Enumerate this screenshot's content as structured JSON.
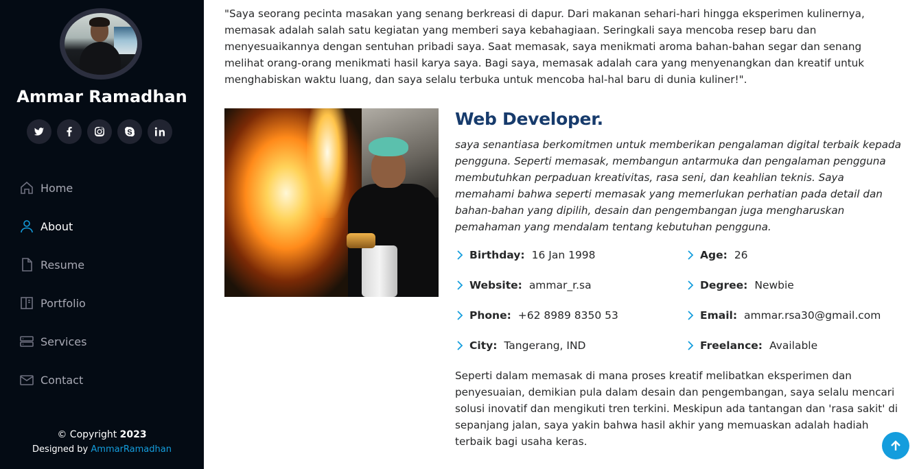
{
  "profile": {
    "name": "Ammar Ramadhan",
    "socials": [
      {
        "icon": "twitter-icon"
      },
      {
        "icon": "facebook-icon"
      },
      {
        "icon": "instagram-icon"
      },
      {
        "icon": "skype-icon"
      },
      {
        "icon": "linkedin-icon"
      }
    ]
  },
  "nav": {
    "items": [
      {
        "label": "Home",
        "icon": "home-icon",
        "active": false
      },
      {
        "label": "About",
        "icon": "person-icon",
        "active": true
      },
      {
        "label": "Resume",
        "icon": "file-icon",
        "active": false
      },
      {
        "label": "Portfolio",
        "icon": "book-half-icon",
        "active": false
      },
      {
        "label": "Services",
        "icon": "server-icon",
        "active": false
      },
      {
        "label": "Contact",
        "icon": "envelope-icon",
        "active": false
      }
    ]
  },
  "footer": {
    "copyright_prefix": "© Copyright",
    "copyright_year": "2023",
    "credits_prefix": "Designed by",
    "credits_link": "AmmarRamadhan"
  },
  "about": {
    "intro": "\"Saya seorang pecinta masakan yang senang berkreasi di dapur. Dari makanan sehari-hari hingga eksperimen kulinernya, memasak adalah salah satu kegiatan yang memberi saya kebahagiaan. Seringkali saya mencoba resep baru dan menyesuaikannya dengan sentuhan pribadi saya. Saat memasak, saya menikmati aroma bahan-bahan segar dan senang melihat orang-orang menikmati hasil karya saya. Bagi saya, memasak adalah cara yang menyenangkan dan kreatif untuk menghabiskan waktu luang, dan saya selalu terbuka untuk mencoba hal-hal baru di dunia kuliner!\".",
    "title": "Web Developer.",
    "lead": "saya senantiasa berkomitmen untuk memberikan pengalaman digital terbaik kepada pengguna. Seperti memasak, membangun antarmuka dan pengalaman pengguna membutuhkan perpaduan kreativitas, rasa seni, dan keahlian teknis. Saya memahami bahwa seperti memasak yang memerlukan perhatian pada detail dan bahan-bahan yang dipilih, desain dan pengembangan juga mengharuskan pemahaman yang mendalam tentang kebutuhan pengguna.",
    "facts": [
      {
        "label": "Birthday:",
        "value": "16 Jan 1998"
      },
      {
        "label": "Age:",
        "value": "26"
      },
      {
        "label": "Website:",
        "value": "ammar_r.sa"
      },
      {
        "label": "Degree:",
        "value": "Newbie"
      },
      {
        "label": "Phone:",
        "value": "+62 8989 8350 53"
      },
      {
        "label": "Email:",
        "value": "ammar.rsa30@gmail.com"
      },
      {
        "label": "City:",
        "value": "Tangerang, IND"
      },
      {
        "label": "Freelance:",
        "value": "Available"
      }
    ],
    "outro": "Seperti dalam memasak di mana proses kreatif melibatkan eksperimen dan penyesuaian, demikian pula dalam desain dan pengembangan, saya selalu mencari solusi inovatif dan mengikuti tren terkini. Meskipun ada tantangan dan 'rasa sakit' di sepanjang jalan, saya yakin bahwa hasil akhir yang memuaskan adalah hadiah terbaik bagi usaha keras."
  },
  "colors": {
    "sidebar_bg": "#040b14",
    "accent": "#149ddd",
    "heading": "#173b6c"
  }
}
